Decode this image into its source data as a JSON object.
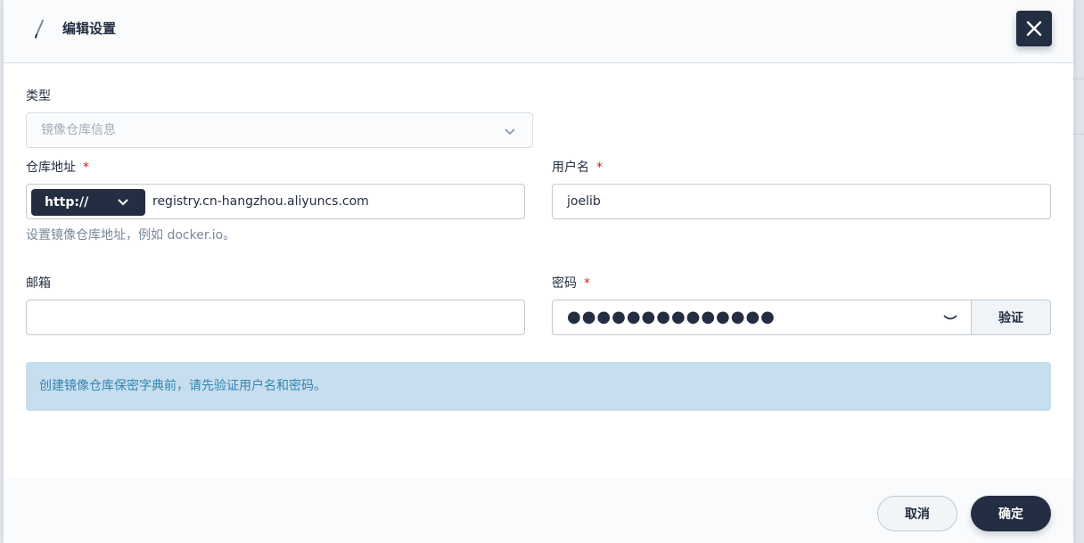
{
  "header": {
    "title": "编辑设置",
    "edit_icon": "pencil-icon",
    "close_icon": "close-icon"
  },
  "form": {
    "type": {
      "label": "类型",
      "value": "镜像仓库信息"
    },
    "registry": {
      "label": "仓库地址",
      "required_mark": "*",
      "protocol": "http://",
      "value": "registry.cn-hangzhou.aliyuncs.com",
      "hint": "设置镜像仓库地址，例如 docker.io。"
    },
    "username": {
      "label": "用户名",
      "required_mark": "*",
      "value": "joelib"
    },
    "email": {
      "label": "邮箱",
      "value": ""
    },
    "password": {
      "label": "密码",
      "required_mark": "*",
      "masked": "●●●●●●●●●●●●●●",
      "verify_label": "验证"
    },
    "alert": "创建镜像仓库保密字典前，请先验证用户名和密码。"
  },
  "footer": {
    "cancel_label": "取消",
    "confirm_label": "确定"
  },
  "colors": {
    "primary": "#242e42",
    "required": "#ca2621",
    "info_bg": "#c7deef",
    "info_text": "#3385b0"
  }
}
